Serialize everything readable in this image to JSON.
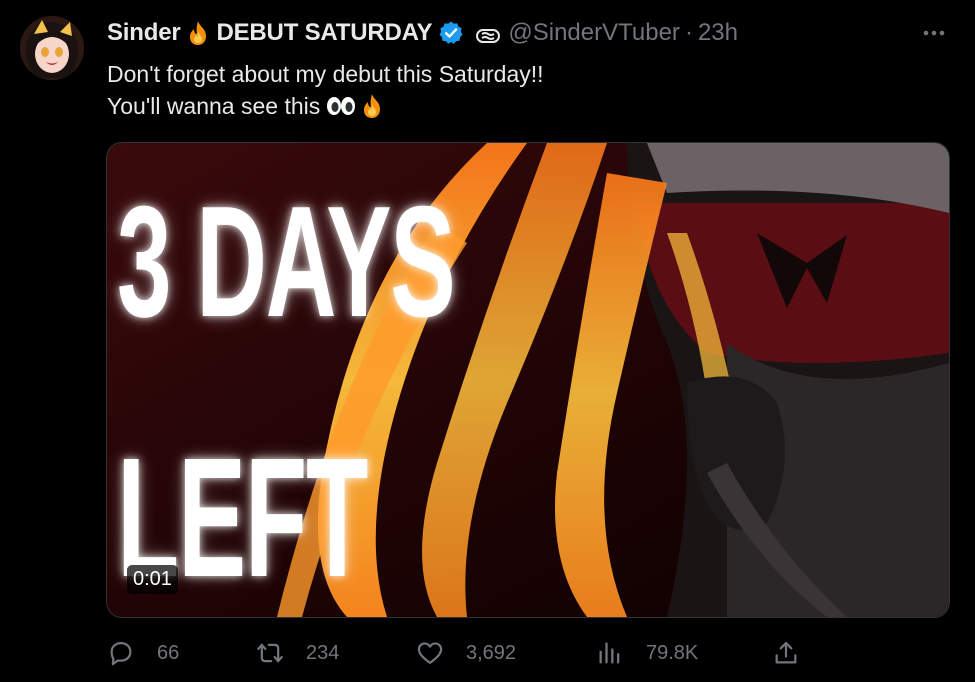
{
  "tweet": {
    "display_name": "Sinder",
    "display_name_suffix": "DEBUT SATURDAY",
    "handle": "@SinderVTuber",
    "time": "23h",
    "text_line1": "Don't forget about my debut this Saturday!!",
    "text_line2": "You'll wanna see this",
    "video": {
      "overlay_line1": "3 DAYS",
      "overlay_line2": "LEFT",
      "duration": "0:01"
    },
    "stats": {
      "replies": "66",
      "retweets": "234",
      "likes": "3,692",
      "views": "79.8K"
    }
  },
  "icons": {
    "name_emoji": "fire-emoji",
    "verified": "verified-badge-icon",
    "subscription": "subscription-badge-icon",
    "more": "more-dots-icon",
    "reply": "reply-icon",
    "retweet": "retweet-icon",
    "like": "heart-icon",
    "views": "views-icon",
    "share": "share-icon"
  },
  "colors": {
    "background": "#000000",
    "text": "#e7e9ea",
    "muted": "#71767b",
    "verified": "#1d9bf0"
  }
}
